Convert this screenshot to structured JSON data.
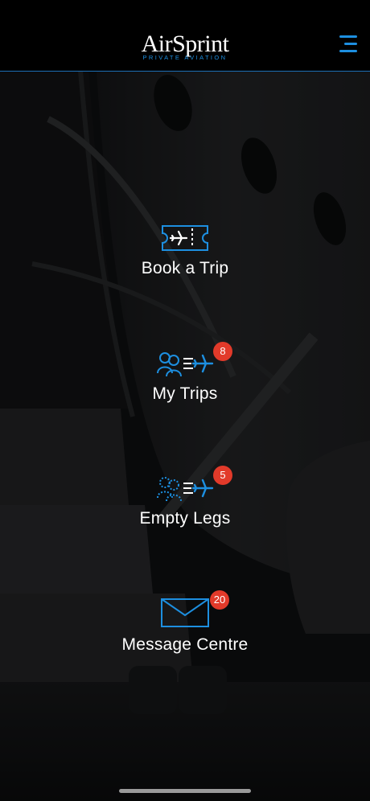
{
  "brand": {
    "name": "AirSprint",
    "tagline": "PRIVATE AVIATION",
    "accent_color": "#1d8fe0",
    "badge_color": "#e23a2a"
  },
  "header": {
    "menu_icon": "hamburger-menu-icon"
  },
  "menu": [
    {
      "label": "Book a Trip",
      "icon": "ticket-plane-icon",
      "badge": null
    },
    {
      "label": "My Trips",
      "icon": "passengers-plane-icon",
      "badge": "8"
    },
    {
      "label": "Empty Legs",
      "icon": "dashed-passengers-plane-icon",
      "badge": "5"
    },
    {
      "label": "Message Centre",
      "icon": "envelope-icon",
      "badge": "20"
    }
  ]
}
